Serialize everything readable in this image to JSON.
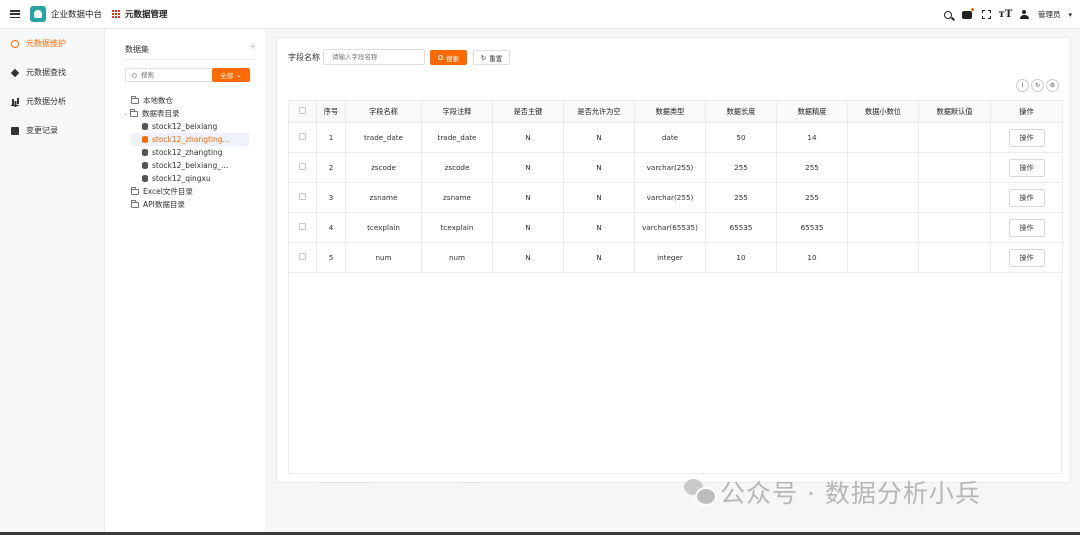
{
  "topbar": {
    "app_title": "企业数据中台",
    "page_title": "元数据管理",
    "user_name": "管理员",
    "font_icon_text": "тT"
  },
  "sidebar": {
    "items": [
      {
        "label": "元数据维护",
        "icon": "gear-icon",
        "active": true
      },
      {
        "label": "元数据查找",
        "icon": "layers-icon",
        "active": false
      },
      {
        "label": "元数据分析",
        "icon": "bar-chart-icon",
        "active": false
      },
      {
        "label": "变更记录",
        "icon": "document-icon",
        "active": false
      }
    ]
  },
  "tree": {
    "header": "数据集",
    "plus": "+",
    "search_placeholder": "搜索",
    "all_button": "全部",
    "nodes": [
      {
        "label": "本地数仓",
        "level": 0,
        "type": "folder"
      },
      {
        "label": "数据表目录",
        "level": 0,
        "type": "folder",
        "expanded": true
      },
      {
        "label": "stock12_beixiang",
        "level": 1,
        "type": "table"
      },
      {
        "label": "stock12_zhangting...",
        "level": 1,
        "type": "table",
        "selected": true
      },
      {
        "label": "stock12_zhangting",
        "level": 1,
        "type": "table"
      },
      {
        "label": "stock12_beixiang_...",
        "level": 1,
        "type": "table"
      },
      {
        "label": "stock12_qingxu",
        "level": 1,
        "type": "table"
      },
      {
        "label": "Excel文件目录",
        "level": 0,
        "type": "folder"
      },
      {
        "label": "API数据目录",
        "level": 0,
        "type": "folder"
      }
    ]
  },
  "filter": {
    "label": "字段名称",
    "placeholder": "请输入字段名称",
    "search_button": "搜索",
    "reset_button": "重置"
  },
  "toolbar_icons": [
    "I",
    "↻",
    "⚙"
  ],
  "table": {
    "columns": [
      "序号",
      "字段名称",
      "字段注释",
      "是否主键",
      "是否允许为空",
      "数据类型",
      "数据长度",
      "数据精度",
      "数据小数位",
      "数据默认值",
      "操作"
    ],
    "rows": [
      {
        "idx": "1",
        "name": "trade_date",
        "comment": "trade_date",
        "pk": "N",
        "nullable": "N",
        "type": "date",
        "length": "50",
        "precision": "14",
        "scale": "",
        "default": "",
        "op": "操作"
      },
      {
        "idx": "2",
        "name": "zscode",
        "comment": "zscode",
        "pk": "N",
        "nullable": "N",
        "type": "varchar(255)",
        "length": "255",
        "precision": "255",
        "scale": "",
        "default": "",
        "op": "操作"
      },
      {
        "idx": "3",
        "name": "zsname",
        "comment": "zsname",
        "pk": "N",
        "nullable": "N",
        "type": "varchar(255)",
        "length": "255",
        "precision": "255",
        "scale": "",
        "default": "",
        "op": "操作"
      },
      {
        "idx": "4",
        "name": "tcexplain",
        "comment": "tcexplain",
        "pk": "N",
        "nullable": "N",
        "type": "varchar(65535)",
        "length": "65535",
        "precision": "65535",
        "scale": "",
        "default": "",
        "op": "操作"
      },
      {
        "idx": "5",
        "name": "num",
        "comment": "num",
        "pk": "N",
        "nullable": "N",
        "type": "integer",
        "length": "10",
        "precision": "10",
        "scale": "",
        "default": "",
        "op": "操作"
      }
    ]
  },
  "watermark": {
    "text": "公众号 · 数据分析小兵"
  },
  "colors": {
    "accent": "#ff6a00",
    "sidebar_bg": "#f7f8fa",
    "selected_row_bg": "#eef2fb"
  }
}
